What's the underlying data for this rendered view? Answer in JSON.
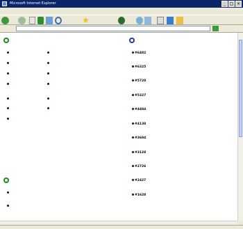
{
  "window": {
    "title": "Microsoft Internet Explorer"
  },
  "menu": [
    "",
    "",
    "",
    "",
    "",
    ""
  ],
  "address": {
    "value": ""
  },
  "status": {
    "zone": ""
  },
  "left": {
    "section1_title": "",
    "section2_title": ""
  },
  "right": {
    "section_title": "",
    "entries": [
      {
        "label": "#6482"
      },
      {
        "label": "#6325"
      },
      {
        "label": "#5720"
      },
      {
        "label": "#5327"
      },
      {
        "label": "#4484"
      },
      {
        "label": "#4130"
      },
      {
        "label": "#3684"
      },
      {
        "label": "#3128"
      },
      {
        "label": "#2726"
      },
      {
        "label": "#2427"
      },
      {
        "label": "#1628"
      }
    ]
  }
}
